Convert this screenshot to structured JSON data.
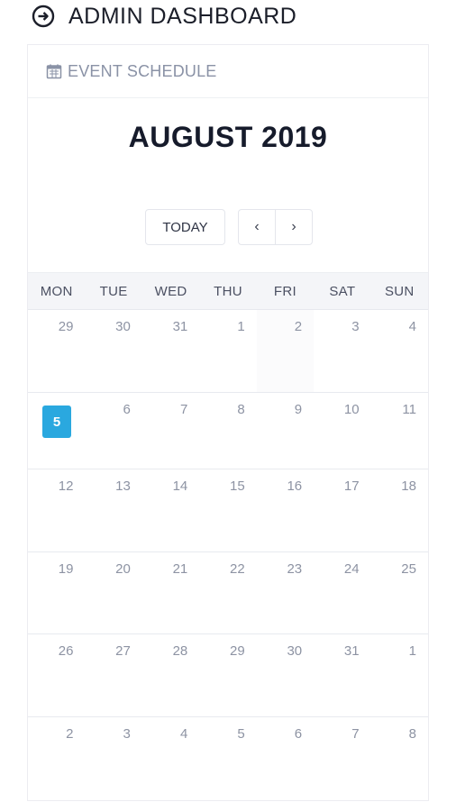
{
  "header": {
    "title": "ADMIN DASHBOARD",
    "icon": "arrow-circle-right-icon"
  },
  "card": {
    "title": "EVENT SCHEDULE",
    "icon": "calendar-icon",
    "month_title": "AUGUST 2019",
    "today_label": "TODAY",
    "prev_label": "‹",
    "next_label": "›",
    "weekdays": [
      "MON",
      "TUE",
      "WED",
      "THU",
      "FRI",
      "SAT",
      "SUN"
    ],
    "weeks": [
      [
        "29",
        "30",
        "31",
        "1",
        "2",
        "3",
        "4"
      ],
      [
        "5",
        "6",
        "7",
        "8",
        "9",
        "10",
        "11"
      ],
      [
        "12",
        "13",
        "14",
        "15",
        "16",
        "17",
        "18"
      ],
      [
        "19",
        "20",
        "21",
        "22",
        "23",
        "24",
        "25"
      ],
      [
        "26",
        "27",
        "28",
        "29",
        "30",
        "31",
        "1"
      ],
      [
        "2",
        "3",
        "4",
        "5",
        "6",
        "7",
        "8"
      ]
    ],
    "today": "5"
  },
  "colors": {
    "accent": "#2aa8df",
    "text": "#1b1e29",
    "muted": "#8d93a3"
  }
}
